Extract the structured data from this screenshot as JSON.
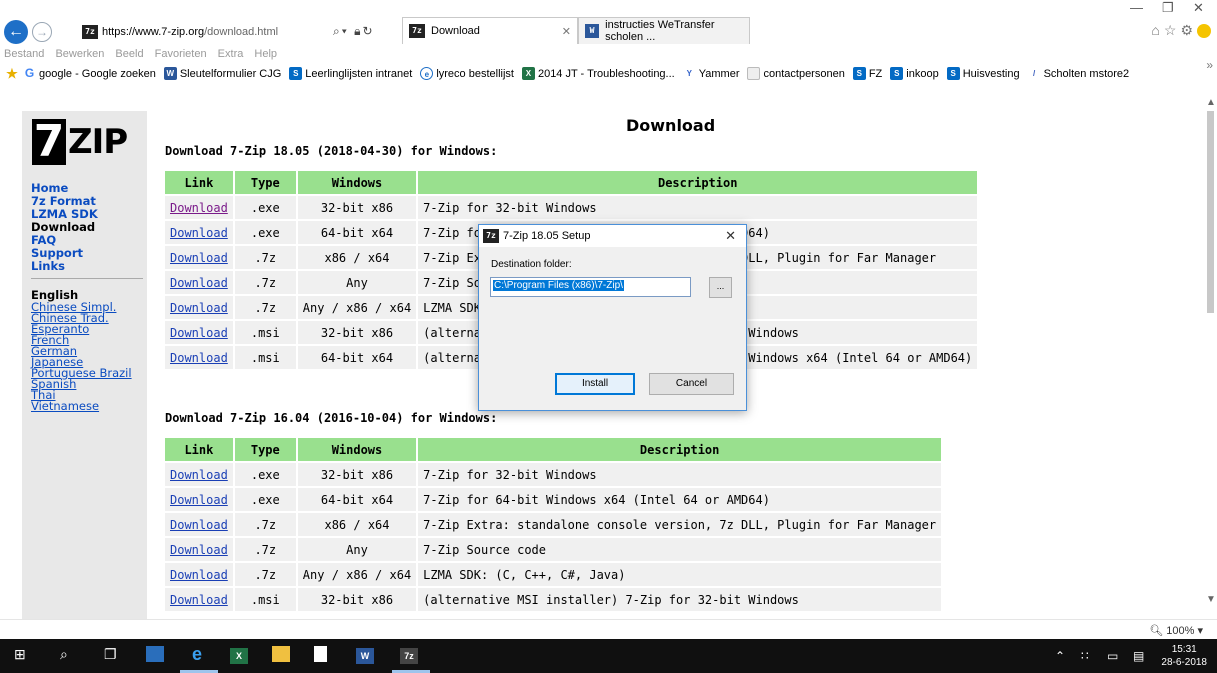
{
  "browser": {
    "url_host": "https://www.7-zip.org",
    "url_path": "/download.html",
    "tabs": [
      {
        "title": "Download",
        "favicon": "7z"
      },
      {
        "title": "instructies WeTransfer scholen ...",
        "favicon": "W"
      }
    ],
    "menu": [
      "Bestand",
      "Bewerken",
      "Beeld",
      "Favorieten",
      "Extra",
      "Help"
    ],
    "favorites": [
      {
        "label": "google - Google zoeken",
        "icon": "google-icon"
      },
      {
        "label": "Sleutelformulier CJG",
        "icon": "word-icon"
      },
      {
        "label": "Leerlinglijsten intranet",
        "icon": "sharepoint-icon"
      },
      {
        "label": "lyreco bestellijst",
        "icon": "ie-icon"
      },
      {
        "label": "2014 JT - Troubleshooting...",
        "icon": "excel-icon"
      },
      {
        "label": "Yammer",
        "icon": "yammer-icon"
      },
      {
        "label": "contactpersonen",
        "icon": "doc-icon"
      },
      {
        "label": "FZ",
        "icon": "sharepoint-icon"
      },
      {
        "label": "inkoop",
        "icon": "sharepoint-icon"
      },
      {
        "label": "Huisvesting",
        "icon": "sharepoint-icon"
      },
      {
        "label": "Scholten mstore2",
        "icon": "feather-icon"
      }
    ],
    "zoom": "100%"
  },
  "page": {
    "title": "Download",
    "nav": {
      "links": [
        "Home",
        "7z Format",
        "LZMA SDK",
        "Download",
        "FAQ",
        "Support",
        "Links"
      ],
      "current": "Download",
      "language_title": "English",
      "languages": [
        "Chinese Simpl.",
        "Chinese Trad.",
        "Esperanto",
        "French",
        "German",
        "Japanese",
        "Portuguese Brazil",
        "Spanish",
        "Thai",
        "Vietnamese"
      ]
    },
    "headers": [
      "Link",
      "Type",
      "Windows",
      "Description"
    ],
    "sections": [
      {
        "heading": "Download 7-Zip 18.05 (2018-04-30) for Windows:",
        "rows": [
          {
            "link": "Download",
            "type": ".exe",
            "windows": "32-bit x86",
            "description": "7-Zip for 32-bit Windows"
          },
          {
            "link": "Download",
            "type": ".exe",
            "windows": "64-bit x64",
            "description": "7-Zip for 64-bit Windows x64 (Intel 64 or AMD64)"
          },
          {
            "link": "Download",
            "type": ".7z",
            "windows": "x86 / x64",
            "description": "7-Zip Extra: standalone console version, 7z DLL, Plugin for Far Manager"
          },
          {
            "link": "Download",
            "type": ".7z",
            "windows": "Any",
            "description": "7-Zip Source code"
          },
          {
            "link": "Download",
            "type": ".7z",
            "windows": "Any / x86 / x64",
            "description": "LZMA SDK: (C, C++, C#, Java)"
          },
          {
            "link": "Download",
            "type": ".msi",
            "windows": "32-bit x86",
            "description": "(alternative MSI installer) 7-Zip for 32-bit Windows"
          },
          {
            "link": "Download",
            "type": ".msi",
            "windows": "64-bit x64",
            "description": "(alternative MSI installer) 7-Zip for 64-bit Windows x64 (Intel 64 or AMD64)"
          }
        ]
      },
      {
        "heading": "Download 7-Zip 16.04 (2016-10-04) for Windows:",
        "rows": [
          {
            "link": "Download",
            "type": ".exe",
            "windows": "32-bit x86",
            "description": "7-Zip for 32-bit Windows"
          },
          {
            "link": "Download",
            "type": ".exe",
            "windows": "64-bit x64",
            "description": "7-Zip for 64-bit Windows x64 (Intel 64 or AMD64)"
          },
          {
            "link": "Download",
            "type": ".7z",
            "windows": "x86 / x64",
            "description": "7-Zip Extra: standalone console version, 7z DLL, Plugin for Far Manager"
          },
          {
            "link": "Download",
            "type": ".7z",
            "windows": "Any",
            "description": "7-Zip Source code"
          },
          {
            "link": "Download",
            "type": ".7z",
            "windows": "Any / x86 / x64",
            "description": "LZMA SDK: (C, C++, C#, Java)"
          },
          {
            "link": "Download",
            "type": ".msi",
            "windows": "32-bit x86",
            "description": "(alternative MSI installer) 7-Zip for 32-bit Windows"
          }
        ]
      }
    ]
  },
  "dialog": {
    "title": "7-Zip 18.05 Setup",
    "label": "Destination folder:",
    "path": "C:\\Program Files (x86)\\7-Zip\\",
    "browse": "...",
    "install": "Install",
    "cancel": "Cancel"
  },
  "taskbar": {
    "time": "15:31",
    "date": "28-6-2018"
  },
  "colors": {
    "table_header": "#99e08e",
    "table_cell": "#f0f0f0",
    "link": "#1a3fb5",
    "taskbar": "#101010"
  }
}
